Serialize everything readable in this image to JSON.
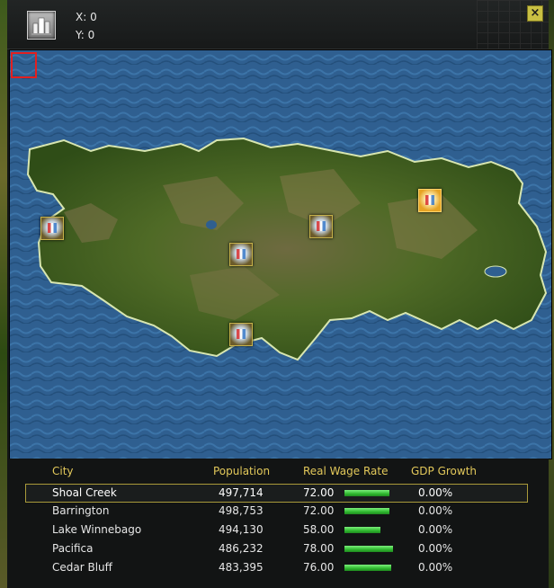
{
  "header": {
    "x_label": "X: 0",
    "y_label": "Y: 0",
    "close_label": "×"
  },
  "map": {
    "markers": [
      {
        "name": "marker-1",
        "selected": false
      },
      {
        "name": "marker-2",
        "selected": false
      },
      {
        "name": "marker-3",
        "selected": false
      },
      {
        "name": "marker-4",
        "selected": true
      },
      {
        "name": "marker-5",
        "selected": false
      }
    ]
  },
  "table": {
    "headers": {
      "city": "City",
      "population": "Population",
      "wage": "Real Wage Rate",
      "gdp": "GDP Growth"
    },
    "rows": [
      {
        "city": "Shoal Creek",
        "population": "497,714",
        "wage": "72.00",
        "wage_value": 72,
        "gdp": "0.00%",
        "selected": true
      },
      {
        "city": "Barrington",
        "population": "498,753",
        "wage": "72.00",
        "wage_value": 72,
        "gdp": "0.00%",
        "selected": false
      },
      {
        "city": "Lake Winnebago",
        "population": "494,130",
        "wage": "58.00",
        "wage_value": 58,
        "gdp": "0.00%",
        "selected": false
      },
      {
        "city": "Pacifica",
        "population": "486,232",
        "wage": "78.00",
        "wage_value": 78,
        "gdp": "0.00%",
        "selected": false
      },
      {
        "city": "Cedar Bluff",
        "population": "483,395",
        "wage": "76.00",
        "wage_value": 76,
        "gdp": "0.00%",
        "selected": false
      }
    ]
  },
  "colors": {
    "header_text": "#e2c85a",
    "bar": "#2fb82f",
    "ocean": "#2e5d8e",
    "land": "#3f5d1f"
  }
}
